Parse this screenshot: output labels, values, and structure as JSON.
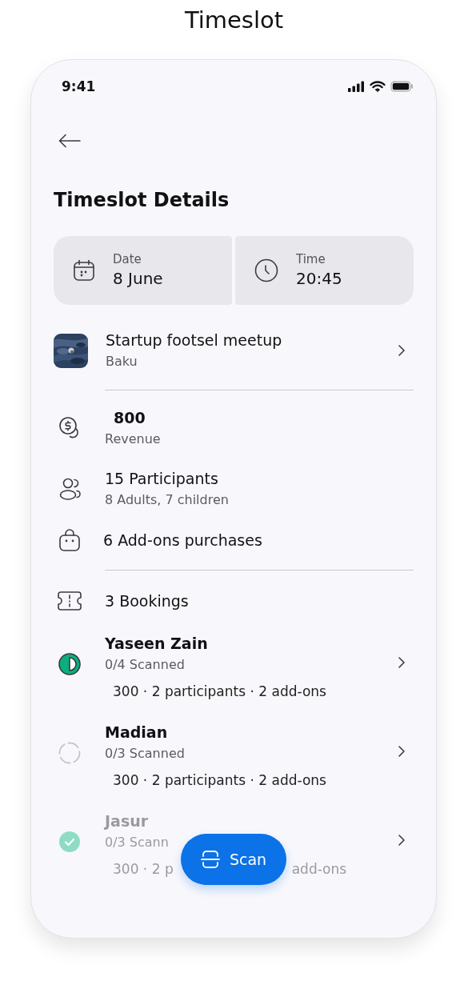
{
  "page_title": "Timeslot",
  "status_bar": {
    "time": "9:41"
  },
  "heading": "Timeslot Details",
  "summary": [
    {
      "kind": "date",
      "label": "Date",
      "value": "8 June"
    },
    {
      "kind": "time",
      "label": "Time",
      "value": "20:45"
    }
  ],
  "event": {
    "title": "Startup footsel meetup",
    "location": "Baku"
  },
  "stats": [
    {
      "kind": "revenue",
      "value": "800",
      "caption": "Revenue"
    },
    {
      "kind": "participants",
      "value": "15 Participants",
      "caption": "8 Adults, 7 children"
    },
    {
      "kind": "addons",
      "value": "6 Add-ons purchases"
    }
  ],
  "bookings": {
    "title": "3 Bookings",
    "items": [
      {
        "name": "Yaseen Zain",
        "kind": "partial",
        "disabled": false,
        "scanned": "0/4 Scanned",
        "details": [
          "300 · 2 participants · 2 add-ons"
        ]
      },
      {
        "name": "Madian",
        "kind": "pending",
        "disabled": false,
        "scanned": "0/3 Scanned",
        "details": [
          "300 · 2 participants · 2 add-ons"
        ]
      },
      {
        "name": "Jasur",
        "kind": "done",
        "disabled": true,
        "scanned": "0/3 Scann",
        "details": [
          "300 · 2 p",
          "add-ons"
        ]
      }
    ]
  },
  "scan_button": {
    "label": "Scan"
  }
}
